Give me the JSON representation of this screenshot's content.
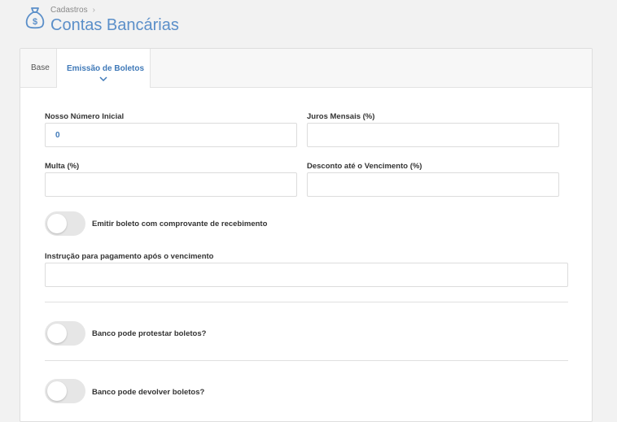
{
  "breadcrumb": {
    "parent": "Cadastros",
    "separator": "›"
  },
  "page_title": "Contas Bancárias",
  "tabs": [
    {
      "label": "Base",
      "active": false
    },
    {
      "label": "Emissão de Boletos",
      "active": true
    }
  ],
  "form": {
    "nosso_numero": {
      "label": "Nosso Número Inicial",
      "value": "0"
    },
    "juros": {
      "label": "Juros Mensais (%)",
      "value": ""
    },
    "multa": {
      "label": "Multa (%)",
      "value": ""
    },
    "desconto": {
      "label": "Desconto até o Vencimento (%)",
      "value": ""
    },
    "emitir_toggle": {
      "label": "Emitir boleto com comprovante de recebimento",
      "on": false
    },
    "instrucao": {
      "label": "Instrução para pagamento após o vencimento",
      "value": ""
    },
    "protestar_toggle": {
      "label": "Banco pode protestar boletos?",
      "on": false
    },
    "devolver_toggle": {
      "label": "Banco pode devolver boletos?",
      "on": false
    }
  },
  "colors": {
    "accent": "#3f79b8",
    "title": "#5b8fc9",
    "toggle_off": "#e6e6e6"
  }
}
